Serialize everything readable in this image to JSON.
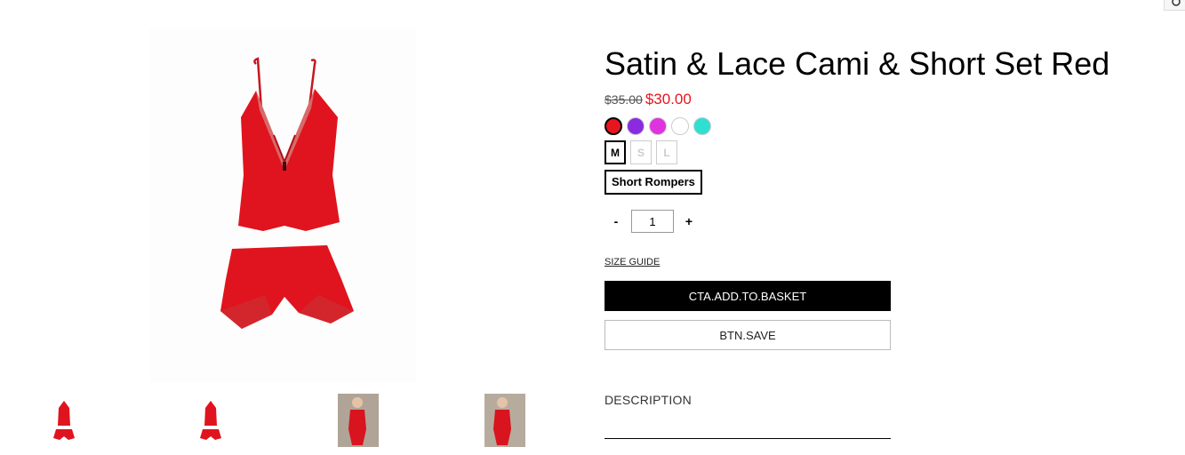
{
  "product": {
    "title": "Satin & Lace Cami & Short Set Red",
    "old_price": "$35.00",
    "new_price": "$30.00",
    "colors": [
      "#e8141e",
      "#8a2be2",
      "#e033e0",
      "#ffffff",
      "#2de0d2"
    ],
    "selected_color_index": 0,
    "sizes": [
      "M",
      "S",
      "L"
    ],
    "selected_size": "M",
    "variant": "Short Rompers",
    "quantity": "1",
    "qty_minus": "-",
    "qty_plus": "+"
  },
  "links": {
    "size_guide": "SIZE GUIDE"
  },
  "buttons": {
    "add_to_basket": "CTA.ADD.TO.BASKET",
    "save": "BTN.SAVE"
  },
  "sections": {
    "description": "DESCRIPTION"
  },
  "gallery": {
    "thumbnails": [
      "product-flat-thumbnail",
      "product-flat-thumbnail",
      "model-photo-thumbnail",
      "model-photo-thumbnail"
    ]
  }
}
